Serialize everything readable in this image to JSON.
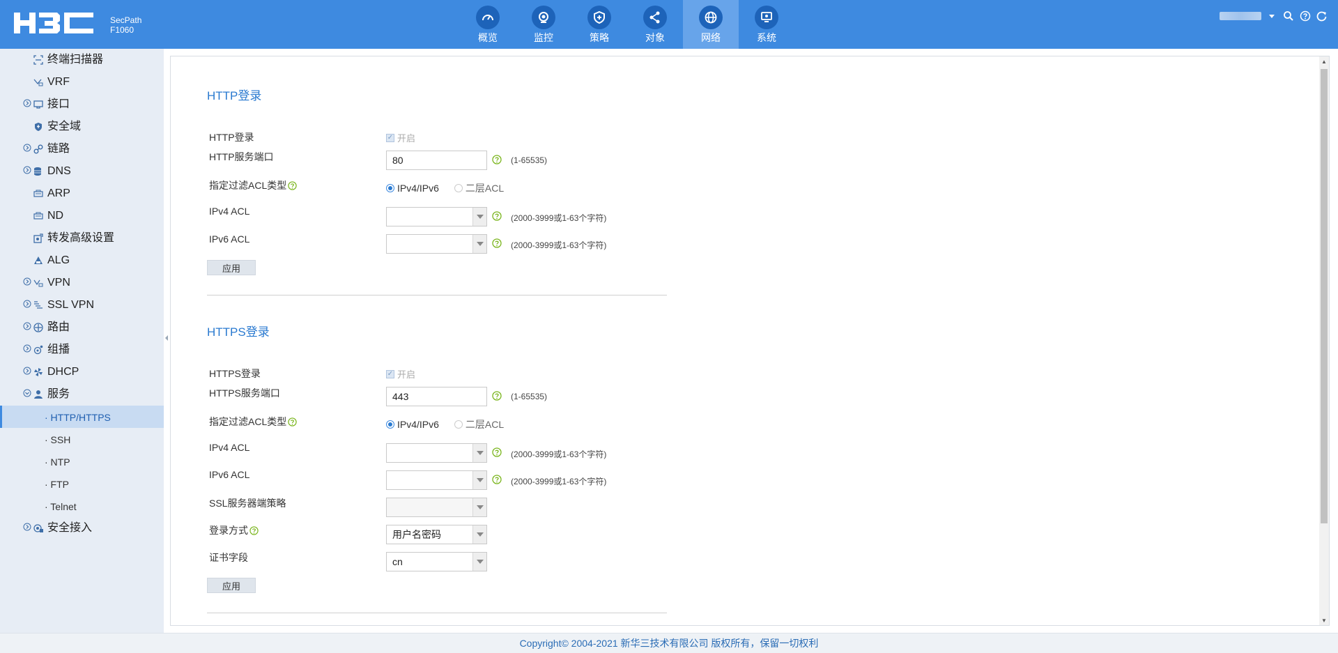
{
  "brand": {
    "logo_text": "H3C",
    "product_line": "SecPath",
    "model": "F1060"
  },
  "nav": [
    {
      "label": "概览",
      "icon": "dashboard-icon"
    },
    {
      "label": "监控",
      "icon": "camera-icon"
    },
    {
      "label": "策略",
      "icon": "shield-plus-icon"
    },
    {
      "label": "对象",
      "icon": "share-icon"
    },
    {
      "label": "网络",
      "icon": "globe-icon",
      "active": true
    },
    {
      "label": "系统",
      "icon": "monitor-icon"
    }
  ],
  "sidebar": {
    "items": [
      {
        "label": "终端扫描器",
        "icon": "scanner-icon",
        "expandable": false
      },
      {
        "label": "VRF",
        "icon": "vrf-icon",
        "expandable": false
      },
      {
        "label": "接口",
        "icon": "interface-icon",
        "expandable": true
      },
      {
        "label": "安全域",
        "icon": "security-zone-icon",
        "expandable": false
      },
      {
        "label": "链路",
        "icon": "link-icon",
        "expandable": true
      },
      {
        "label": "DNS",
        "icon": "dns-icon",
        "expandable": true
      },
      {
        "label": "ARP",
        "icon": "arp-icon",
        "expandable": false
      },
      {
        "label": "ND",
        "icon": "nd-icon",
        "expandable": false
      },
      {
        "label": "转发高级设置",
        "icon": "forwarding-settings-icon",
        "expandable": false
      },
      {
        "label": "ALG",
        "icon": "alg-icon",
        "expandable": false
      },
      {
        "label": "VPN",
        "icon": "vpn-icon",
        "expandable": true
      },
      {
        "label": "SSL VPN",
        "icon": "ssl-vpn-icon",
        "expandable": true
      },
      {
        "label": "路由",
        "icon": "routing-icon",
        "expandable": true
      },
      {
        "label": "组播",
        "icon": "multicast-icon",
        "expandable": true
      },
      {
        "label": "DHCP",
        "icon": "dhcp-icon",
        "expandable": true
      },
      {
        "label": "服务",
        "icon": "service-icon",
        "expandable": true,
        "expanded": true
      }
    ],
    "service_children": [
      {
        "label": "· HTTP/HTTPS",
        "active": true
      },
      {
        "label": "· SSH"
      },
      {
        "label": "· NTP"
      },
      {
        "label": "· FTP"
      },
      {
        "label": "· Telnet"
      }
    ],
    "last_item": {
      "label": "安全接入",
      "icon": "secure-access-icon",
      "expandable": true
    }
  },
  "http": {
    "title": "HTTP登录",
    "login_label": "HTTP登录",
    "enable_label": "开启",
    "port_label": "HTTP服务端口",
    "port_value": "80",
    "port_hint": "(1-65535)",
    "acl_type_label": "指定过滤ACL类型",
    "acl_type_options": [
      "IPv4/IPv6",
      "二层ACL"
    ],
    "ipv4_acl_label": "IPv4 ACL",
    "ipv6_acl_label": "IPv6 ACL",
    "acl_hint": "(2000-3999或1-63个字符)",
    "apply_label": "应用"
  },
  "https": {
    "title": "HTTPS登录",
    "login_label": "HTTPS登录",
    "enable_label": "开启",
    "port_label": "HTTPS服务端口",
    "port_value": "443",
    "port_hint": "(1-65535)",
    "acl_type_label": "指定过滤ACL类型",
    "acl_type_options": [
      "IPv4/IPv6",
      "二层ACL"
    ],
    "ipv4_acl_label": "IPv4 ACL",
    "ipv6_acl_label": "IPv6 ACL",
    "acl_hint": "(2000-3999或1-63个字符)",
    "ssl_policy_label": "SSL服务器端策略",
    "login_method_label": "登录方式",
    "login_method_value": "用户名密码",
    "cert_field_label": "证书字段",
    "cert_field_value": "cn",
    "apply_label": "应用"
  },
  "footer": {
    "copyright": "Copyright© 2004-2021 新华三技术有限公司 版权所有，保留一切权利"
  },
  "colors": {
    "topbar": "#3e8ae0",
    "nav_icon_bg": "#1d63b9",
    "accent": "#2a7ad0",
    "help_green": "#7ab51d"
  }
}
